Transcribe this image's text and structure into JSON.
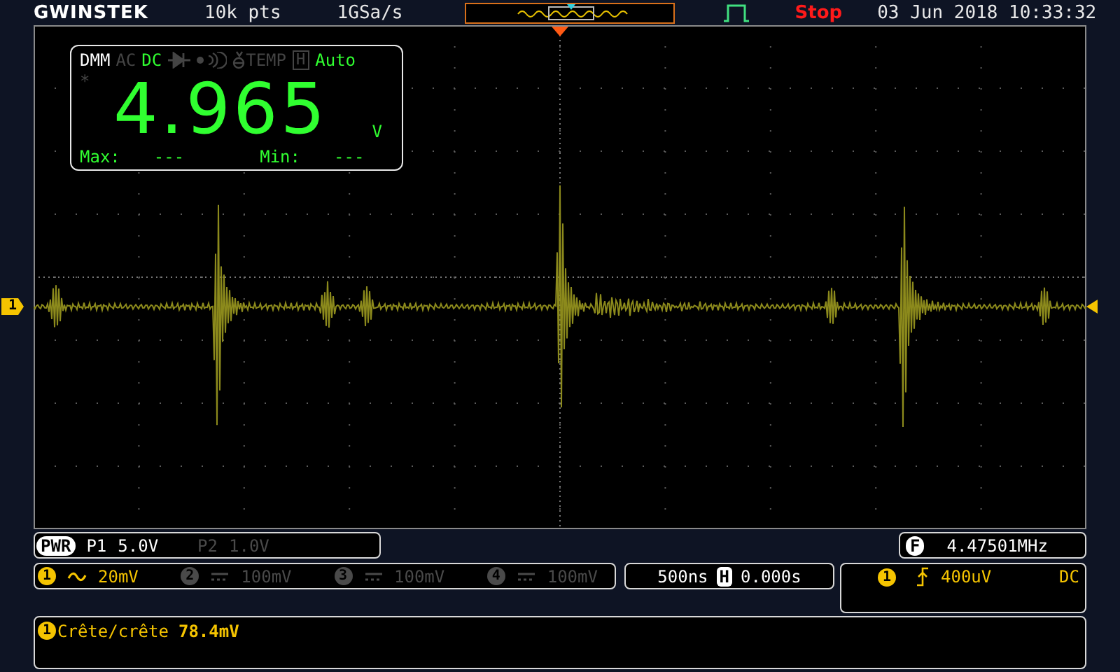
{
  "header": {
    "logo": "GWINSTEK",
    "record_length": "10k pts",
    "sample_rate": "1GSa/s",
    "run_state": "Stop",
    "date_time": "03 Jun 2018 10:33:32"
  },
  "dmm": {
    "title": "DMM",
    "modes": [
      {
        "kind": "text",
        "label": "AC",
        "selected": false
      },
      {
        "kind": "text",
        "label": "DC",
        "selected": true
      },
      {
        "kind": "diode",
        "selected": false
      },
      {
        "kind": "continuity",
        "selected": false
      },
      {
        "kind": "temp",
        "label": "TEMP",
        "selected": false
      }
    ],
    "hold": {
      "label": "H",
      "on": false
    },
    "range": "Auto",
    "relative": "*",
    "reading": "4.965",
    "unit": "V",
    "max_label": "Max:",
    "max_value": "---",
    "min_label": "Min:",
    "min_value": "---"
  },
  "channel_marker": "1",
  "power": {
    "badge": "PWR",
    "probes": [
      {
        "label": "P1",
        "value": "5.0V",
        "enabled": true
      },
      {
        "label": "P2",
        "value": "1.0V",
        "enabled": false
      }
    ]
  },
  "frequency": {
    "badge": "F",
    "value": "4.47501MHz"
  },
  "channels": [
    {
      "number": "1",
      "ac_coupled": true,
      "scale": "20mV",
      "enabled": true
    },
    {
      "number": "2",
      "ac_coupled": false,
      "scale": "100mV",
      "enabled": false
    },
    {
      "number": "3",
      "ac_coupled": false,
      "scale": "100mV",
      "enabled": false
    },
    {
      "number": "4",
      "ac_coupled": false,
      "scale": "100mV",
      "enabled": false
    }
  ],
  "timebase": {
    "scale": "500ns",
    "badge": "H",
    "position": "0.000s"
  },
  "trigger": {
    "source": "1",
    "rising_edge": true,
    "level": "400uV",
    "coupling": "DC"
  },
  "measurement": {
    "source": "1",
    "label": "Crête/crête",
    "value": "78.4mV"
  }
}
